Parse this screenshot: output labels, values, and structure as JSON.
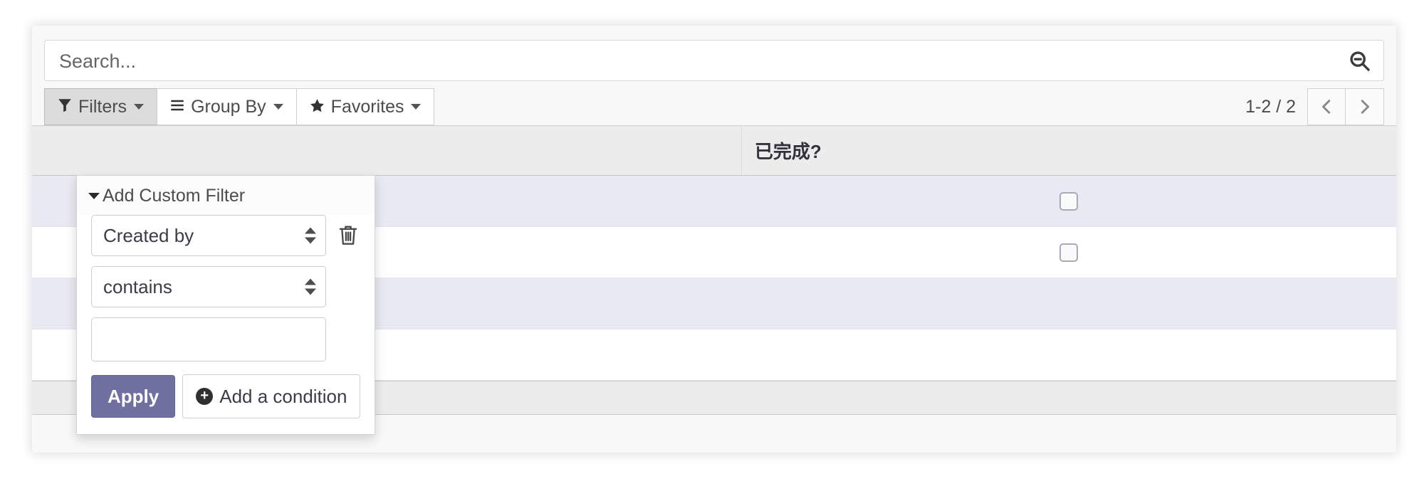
{
  "search": {
    "placeholder": "Search...",
    "value": "",
    "icon": "magnifier-minus-icon"
  },
  "toolbar": {
    "buttons": [
      {
        "label": "Filters",
        "icon": "funnel-icon",
        "active": true
      },
      {
        "label": "Group By",
        "icon": "hamburger-icon",
        "active": false
      },
      {
        "label": "Favorites",
        "icon": "star-icon",
        "active": false
      }
    ],
    "pager": {
      "label": "1-2 / 2",
      "previous_icon": "chevron-left-icon",
      "next_icon": "chevron-right-icon"
    }
  },
  "filter_dropdown": {
    "header": "Add Custom Filter",
    "header_caret_icon": "caret-down-icon",
    "field_select": {
      "value": "Created by",
      "spinner_icon": "updown-spinner-icon"
    },
    "operator_select": {
      "value": "contains",
      "spinner_icon": "updown-spinner-icon"
    },
    "value_input": {
      "value": "",
      "placeholder": ""
    },
    "delete_icon": "trash-icon",
    "apply_label": "Apply",
    "add_condition_label": "Add a condition",
    "add_condition_icon": "plus-circle-icon"
  },
  "list": {
    "columns": [
      {
        "label": "",
        "width": "52%"
      },
      {
        "label": "已完成?",
        "width": "48%"
      }
    ],
    "rows": [
      {
        "cells": [
          "",
          "checkbox"
        ],
        "checked": false
      },
      {
        "cells": [
          "",
          "checkbox"
        ],
        "checked": false
      },
      {
        "cells": [
          "",
          ""
        ]
      },
      {
        "cells": [
          "",
          ""
        ]
      }
    ]
  },
  "colors": {
    "accent_purple": "#6f6fa0",
    "row_alt": "#e9e9f3",
    "header_gray": "#ececed",
    "panel_bg": "#f8f8f8"
  }
}
